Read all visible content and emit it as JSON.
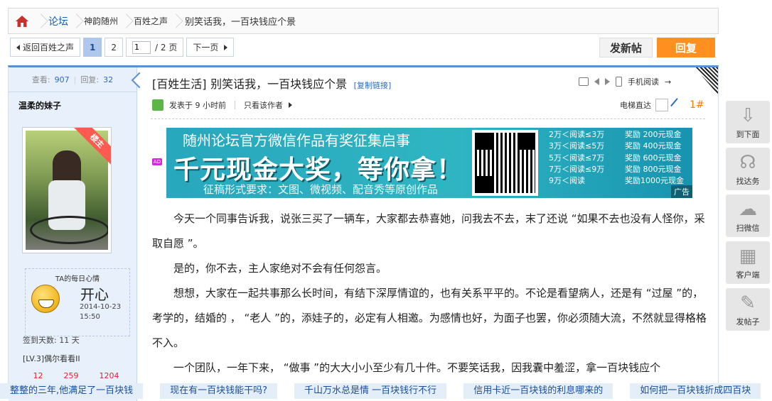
{
  "breadcrumb": {
    "home": "home",
    "items": [
      "论坛",
      "神韵随州",
      "百姓之声"
    ],
    "title": "别笑话我，一百块钱应个景"
  },
  "pager": {
    "back": "返回百姓之声",
    "pages": [
      "1",
      "2"
    ],
    "input": "1",
    "total": "/ 2 页",
    "next": "下一页"
  },
  "actions": {
    "post": "发新帖",
    "reply": "回复"
  },
  "user": {
    "views_label": "查看:",
    "views": "907",
    "replies_label": "回复:",
    "replies": "32",
    "name": "温柔的妹子",
    "badge": "楼主",
    "mood_title": "TA的每日心情",
    "mood": "开心",
    "mood_date": "2014-10-23",
    "mood_time": "15:50",
    "signin": "签到天数: 11 天",
    "level": "[LV.3]偶尔看看II",
    "stats": [
      "12",
      "259",
      "1204"
    ]
  },
  "post": {
    "category": "[百姓生活]",
    "title": "别笑话我，一百块钱应个景",
    "copy_link": "[复制链接]",
    "mobile": "手机阅读",
    "posted": "发表于 9 小时前",
    "only_author": "只看该作者",
    "elevator": "电梯直达",
    "floor": "1#",
    "paragraphs": [
      "　　今天一个同事告诉我，说张三买了一辆车，大家都去恭喜她，问我去不去，末了还说 “如果不去也没有人怪你，采取自愿 ”。",
      "　　是的，你不去，主人家绝对不会有任何怨言。",
      "　　想想，大家在一起共事那么长时间，有结下深厚情谊的，也有关系平平的。不论是看望病人，还是有 “过屋 ”的，考学的，结婚的 ， “老人 ”的，添娃子的，必定有人相邀。为感情也好，为面子也罢，你必须随大流，不然就显得格格不入。",
      "　　一个团队，一年下来， “做事 ”的大大小小至少有几十件。不要笑话我，因我囊中羞涩，拿一百块钱应个"
    ]
  },
  "ad": {
    "tag": "AD",
    "headline": "随州论坛官方微信作品有奖征集启事",
    "big": "千元现金大奖，等你拿！",
    "sub": "征稿形式要求：文图、微视频、配音秀等原创作品",
    "tiers": [
      "2万＜阅读≤3万",
      "3万＜阅读≤5万",
      "5万＜阅读≤7万",
      "7万＜阅读≤9万",
      "9万＜阅读"
    ],
    "rewards": [
      "奖励 200元现金",
      "奖励 400元现金",
      "奖励 600元现金",
      "奖励 800元现金",
      "奖励1000元现金"
    ],
    "label": "广告"
  },
  "float": [
    "到下面",
    "找达务",
    "扫微信",
    "客户端",
    "发帖子"
  ],
  "bottom": [
    "整整的三年,他满足了一百块钱",
    "现在有一百块钱能干吗?",
    "千山万水总是情 一百块钱行不行",
    "信用卡近一百块钱的利息哪来的",
    "如何把一百块钱折成四百块"
  ]
}
